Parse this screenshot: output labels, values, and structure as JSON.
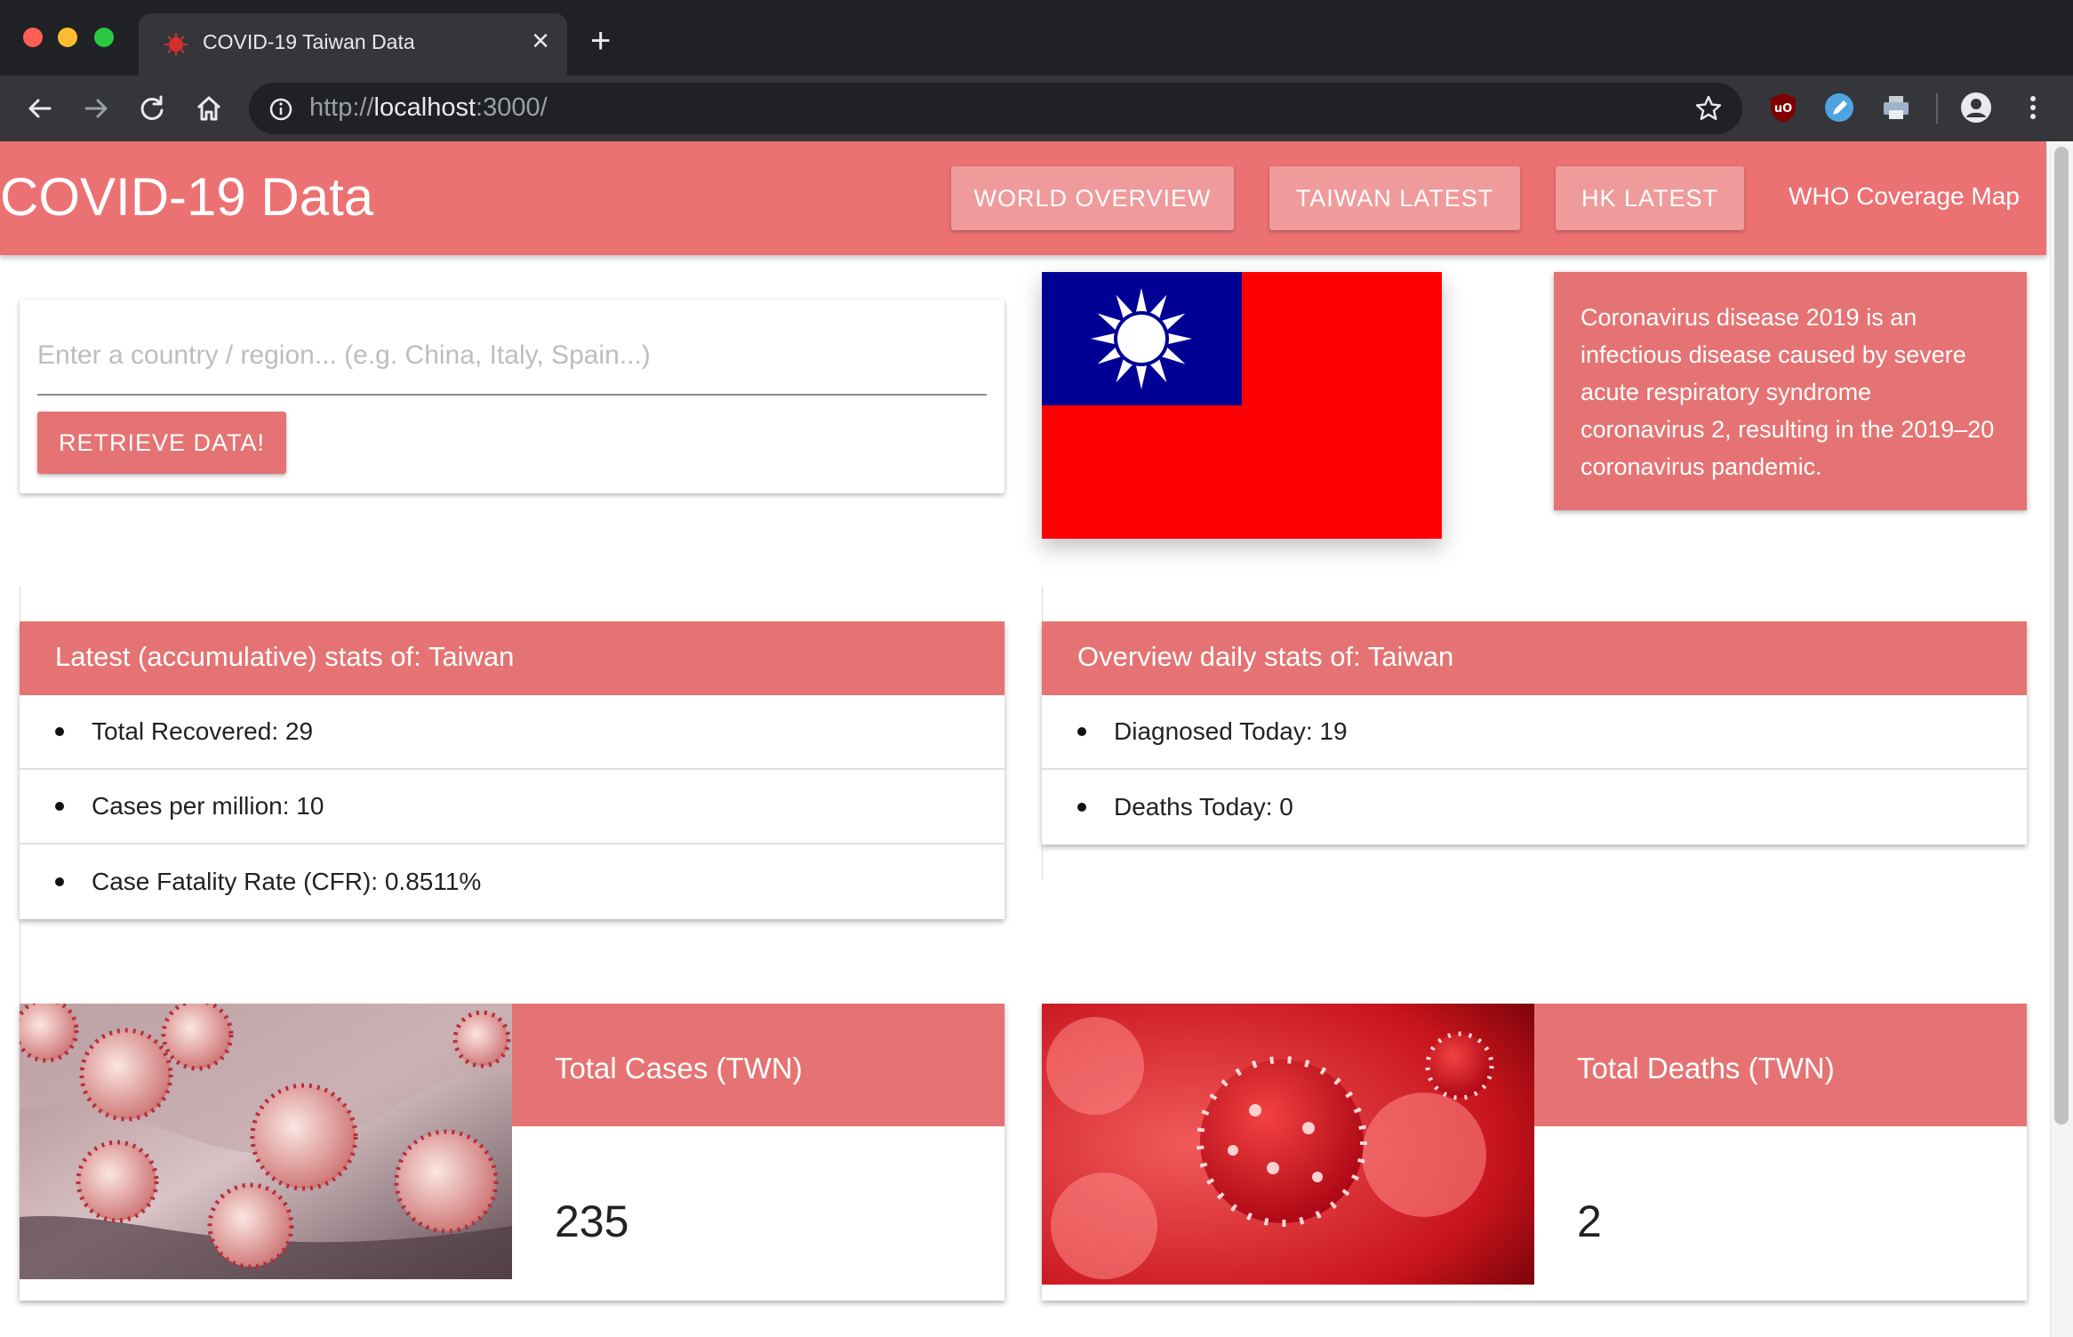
{
  "browser": {
    "tab_title": "COVID-19 Taiwan Data",
    "tab_close": "×",
    "new_tab": "+",
    "url_scheme": "http://",
    "url_host": "localhost",
    "url_rest": ":3000/"
  },
  "app_bar": {
    "title": "COVID-19 Data",
    "nav": [
      {
        "label": "WORLD OVERVIEW"
      },
      {
        "label": "TAIWAN LATEST"
      },
      {
        "label": "HK LATEST"
      }
    ],
    "link_label": "WHO Coverage Map"
  },
  "search": {
    "placeholder": "Enter a country / region... (e.g. China, Italy, Spain...)",
    "button_label": "RETRIEVE DATA!"
  },
  "info": {
    "text": "Coronavirus disease 2019 is an infectious disease caused by severe acute respiratory syndrome coronavirus 2, resulting in the 2019–20 coronavirus pandemic."
  },
  "latest_stats": {
    "title": "Latest (accumulative) stats of: Taiwan",
    "items": [
      {
        "text": "Total Recovered: 29"
      },
      {
        "text": "Cases per million: 10"
      },
      {
        "text": "Case Fatality Rate (CFR): 0.8511%"
      }
    ]
  },
  "daily_stats": {
    "title": "Overview daily stats of: Taiwan",
    "items": [
      {
        "text": "Diagnosed Today: 19"
      },
      {
        "text": "Deaths Today: 0"
      }
    ]
  },
  "total_cases": {
    "label": "Total Cases (TWN)",
    "value": "235"
  },
  "total_deaths": {
    "label": "Total Deaths (TWN)",
    "value": "2"
  },
  "colors": {
    "app_bar": "#ec7173",
    "card_header": "#e57373",
    "nav_button": "#ef9b9c",
    "flag_red": "#fe0000",
    "flag_blue": "#000095"
  }
}
